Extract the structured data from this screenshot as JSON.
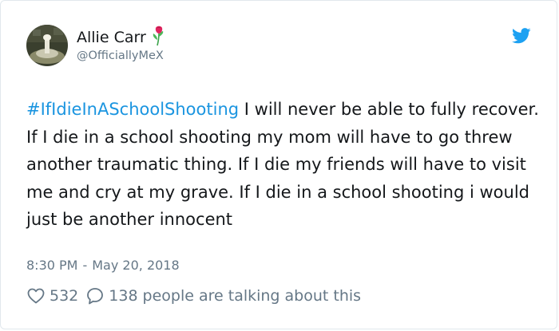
{
  "user": {
    "display_name": "Allie Carr",
    "handle": "@OfficiallyMeX",
    "emoji_icon": "rose-icon",
    "avatar_icon": "avatar"
  },
  "platform_icon": "twitter-bird-icon",
  "tweet": {
    "hashtag": "#IfIdieInASchoolShooting",
    "text": " I will never be able to fully recover. If I die in a school shooting my mom will have to go threw another traumatic thing. If I die my friends will have to visit me and cry at my grave. If I die in a school shooting i would just be another innocent",
    "time": "8:30 PM",
    "separator": "-",
    "date": "May 20, 2018"
  },
  "engagement": {
    "likes": "532",
    "replies": "138",
    "talking_label": "people are talking about this"
  },
  "colors": {
    "link": "#1b95e0",
    "secondary_text": "#657786",
    "primary_text": "#14171a",
    "twitter_blue": "#1da1f2"
  }
}
